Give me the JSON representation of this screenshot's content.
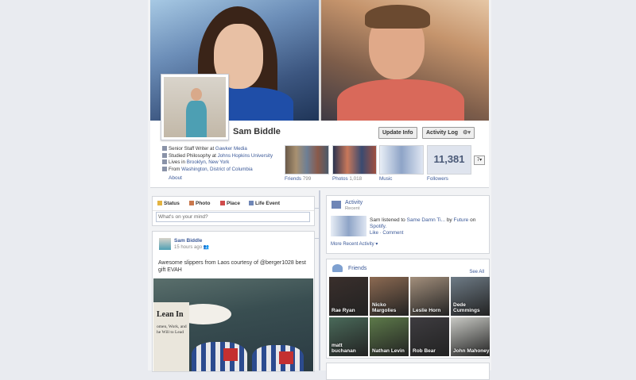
{
  "profile": {
    "name": "Sam Biddle",
    "update_info": "Update Info",
    "activity_log": "Activity Log"
  },
  "info": {
    "job_prefix": "Senior Staff Writer at ",
    "job_link": "Gawker Media",
    "edu_prefix": "Studied Philosophy at ",
    "edu_link": "Johns Hopkins University",
    "lives_prefix": "Lives in ",
    "lives_link": "Brooklyn, New York",
    "from_prefix": "From ",
    "from_link": "Washington, District of Columbia",
    "about": "About"
  },
  "stats": {
    "friends_label": "Friends",
    "friends_count": "799",
    "photos_label": "Photos",
    "photos_count": "1,018",
    "music_label": "Music",
    "followers_label": "Followers",
    "followers_count": "11,381",
    "more": "7▾"
  },
  "composer": {
    "tabs": [
      "Status",
      "Photo",
      "Place",
      "Life Event"
    ],
    "placeholder": "What's on your mind?"
  },
  "post": {
    "author": "Sam Biddle",
    "time": "15 hours ago",
    "text": "Awesome slippers from Laos courtesy of @berger1028 best gift EVAH",
    "book_title": "Lean In",
    "book_sub": "omen, Work, and\nhe Will to Lead"
  },
  "activity": {
    "title": "Activity",
    "subtitle": "Recent",
    "text_prefix": "Sam listened to ",
    "song": "Same Damn Ti...",
    "by": " by ",
    "artist": "Future",
    "on": " on ",
    "service": "Spotify.",
    "like": "Like",
    "comment": "Comment",
    "more": "More Recent Activity"
  },
  "friends": {
    "title": "Friends",
    "see_all": "See All",
    "list": [
      {
        "name": "Rae Ryan",
        "color": "#3a2f2c"
      },
      {
        "name": "Nicko Margolies",
        "color": "#8c6a52"
      },
      {
        "name": "Leslie Horn",
        "color": "#a38f7c"
      },
      {
        "name": "Dede Cummings",
        "color": "#6e7b86"
      },
      {
        "name": "matt buchanan",
        "color": "#4a6a5a"
      },
      {
        "name": "Nathan Levin",
        "color": "#5d7a4a"
      },
      {
        "name": "Rob Bear",
        "color": "#3e3c40"
      },
      {
        "name": "John Mahoney",
        "color": "#c8c9c4"
      }
    ]
  }
}
